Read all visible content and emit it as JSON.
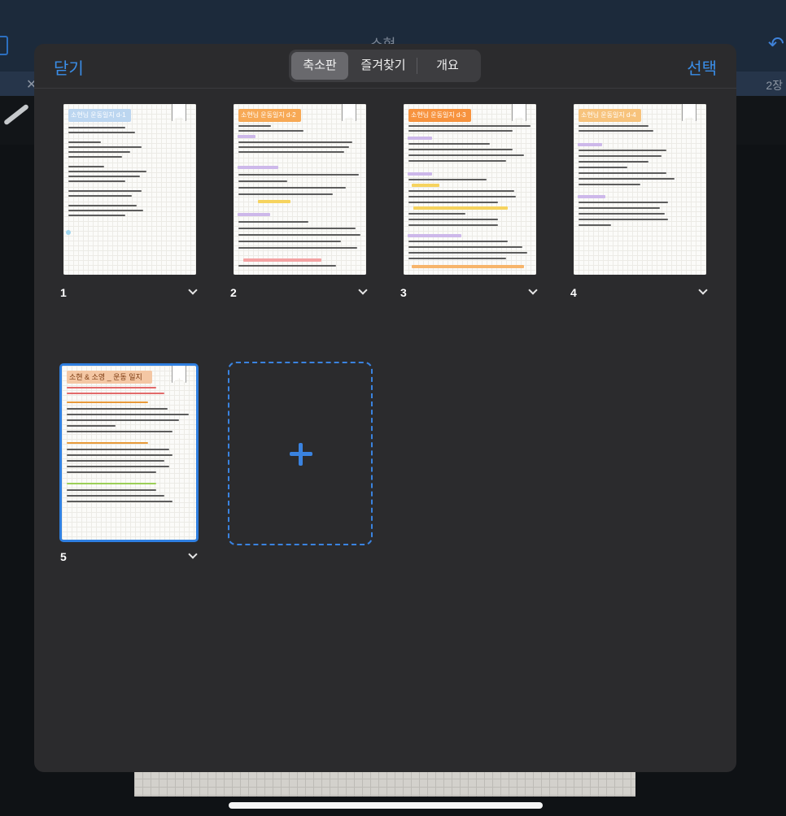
{
  "background": {
    "document_title": "소현",
    "page_count": "2장"
  },
  "sheet": {
    "close_label": "닫기",
    "select_label": "선택",
    "segments": [
      {
        "label": "축소판",
        "active": true
      },
      {
        "label": "즐겨찾기",
        "active": false
      },
      {
        "label": "개요",
        "active": false
      }
    ],
    "accent_color": "#3a8ee8"
  },
  "pages": [
    {
      "number": "1",
      "title": "소현님 운동일지 d-1",
      "title_color": "#bcd6f0",
      "selected": false
    },
    {
      "number": "2",
      "title": "소현님 운동일지 d-2",
      "title_color": "#f7a955",
      "selected": false
    },
    {
      "number": "3",
      "title": "소현님 운동일지 d-3",
      "title_color": "#f7933e",
      "selected": false
    },
    {
      "number": "4",
      "title": "소현님 운동일지 d-4",
      "title_color": "#f7c37c",
      "selected": false
    },
    {
      "number": "5",
      "title": "소현 & 소영 _ 운동 일지",
      "title_color": "#f4c7a4",
      "selected": true
    }
  ],
  "icons": {
    "add": "plus-icon",
    "expand": "chevron-down-icon",
    "bookmark": "bookmark-icon"
  }
}
